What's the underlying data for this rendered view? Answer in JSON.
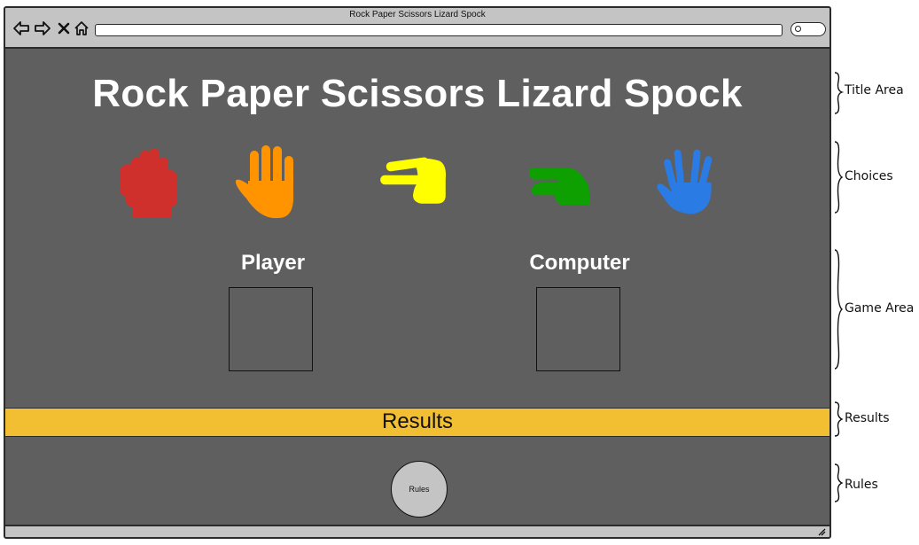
{
  "window": {
    "title": "Rock  Paper  Scissors  Lizard  Spock"
  },
  "page": {
    "title": "Rock Paper Scissors Lizard Spock",
    "choices": [
      {
        "name": "rock",
        "icon": "fist-icon",
        "color": "#d0302b"
      },
      {
        "name": "paper",
        "icon": "open-hand-icon",
        "color": "#ff9400"
      },
      {
        "name": "scissors",
        "icon": "scissors-hand-icon",
        "color": "#ffff00"
      },
      {
        "name": "lizard",
        "icon": "lizard-hand-icon",
        "color": "#0ea000"
      },
      {
        "name": "spock",
        "icon": "vulcan-salute-icon",
        "color": "#2b7be4"
      }
    ],
    "player_label": "Player",
    "computer_label": "Computer",
    "results_label": "Results",
    "rules_label": "Rules",
    "colors": {
      "background": "#5f5f5f",
      "results_bar": "#f2be32",
      "chrome": "#c4c4c4"
    }
  },
  "annotations": {
    "title_area": "Title Area",
    "choices": "Choices",
    "game_area": "Game Area",
    "results": "Results",
    "rules": "Rules"
  }
}
